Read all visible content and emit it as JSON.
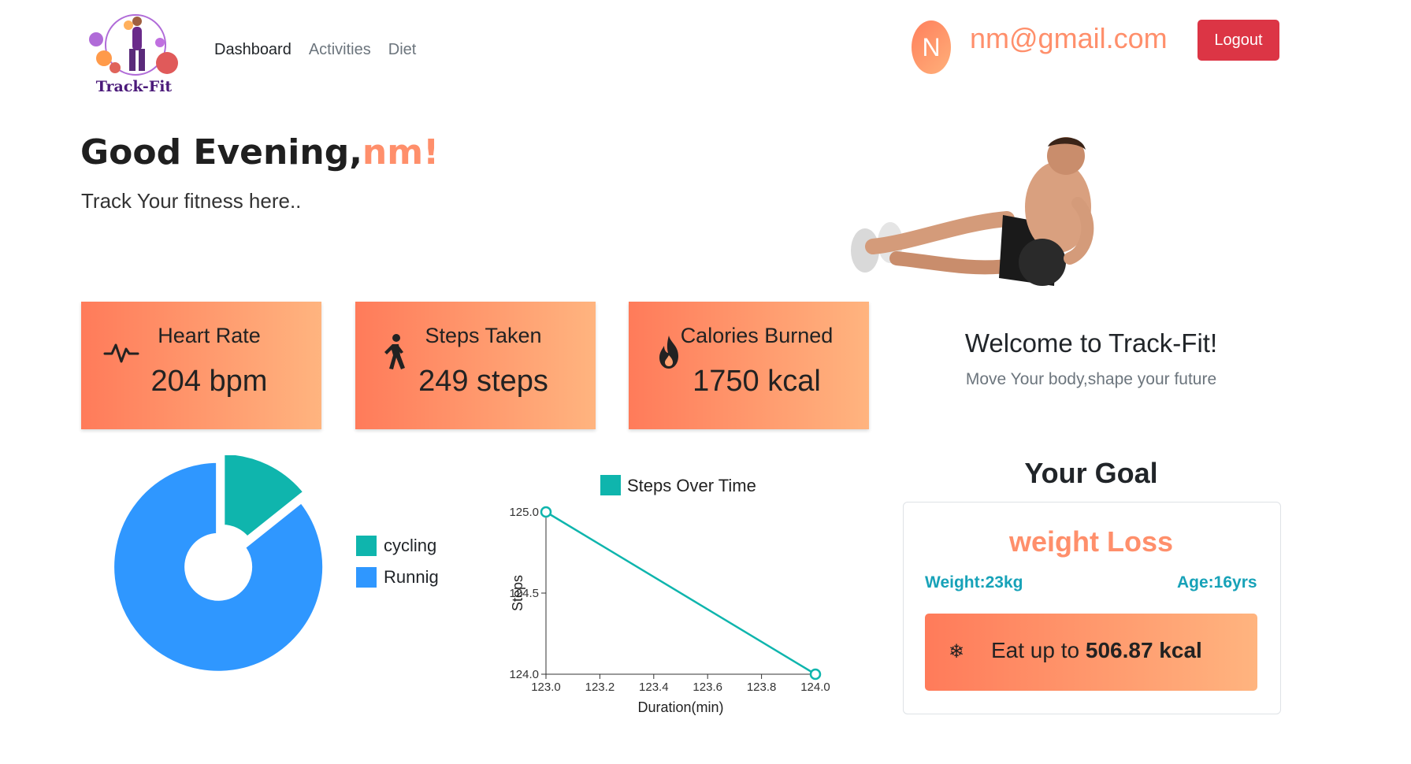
{
  "nav": {
    "logo_text": "Track-Fit",
    "items": [
      "Dashboard",
      "Activities",
      "Diet"
    ]
  },
  "user": {
    "avatar_letter": "N",
    "email": "nm@gmail.com",
    "logout_label": "Logout"
  },
  "greeting": {
    "prefix": "Good Evening,",
    "name": "nm!",
    "subtitle": "Track Your fitness here.."
  },
  "stats": [
    {
      "label": "Heart Rate",
      "value": "204 bpm",
      "icon": "heartbeat-icon"
    },
    {
      "label": "Steps Taken",
      "value": "249 steps",
      "icon": "walking-icon"
    },
    {
      "label": "Calories Burned",
      "value": "1750 kcal",
      "icon": "fire-icon"
    }
  ],
  "welcome": {
    "title": "Welcome to Track-Fit!",
    "tagline": "Move Your body,shape your future"
  },
  "goal": {
    "heading": "Your Goal",
    "name": "weight Loss",
    "weight": "Weight:23kg",
    "age": "Age:16yrs",
    "eat_prefix": "Eat up to",
    "eat_value": "506.87 kcal",
    "eat_icon": "snowflake-icon"
  },
  "colors": {
    "accent": "#ff8f6b",
    "teal": "#0fb5ad",
    "blue": "#2f97ff",
    "danger": "#dc3545",
    "info": "#17a2b8"
  },
  "chart_data": [
    {
      "type": "pie",
      "labels": [
        "cycling",
        "Runnig"
      ],
      "values": [
        1,
        6
      ],
      "colors": [
        "#0fb5ad",
        "#2f97ff"
      ],
      "legend_position": "right"
    },
    {
      "type": "line",
      "title": "Steps Over Time",
      "xlabel": "Duration(min)",
      "ylabel": "Steps",
      "series": [
        {
          "name": "Steps Over Time",
          "x": [
            123.0,
            124.0
          ],
          "y": [
            125.0,
            124.0
          ],
          "color": "#0fb5ad"
        }
      ],
      "xlim": [
        123.0,
        124.0
      ],
      "ylim": [
        124.0,
        125.0
      ],
      "xticks": [
        "123.0",
        "123.2",
        "123.4",
        "123.6",
        "123.8",
        "124.0"
      ],
      "yticks": [
        "124.0",
        "124.5",
        "125.0"
      ],
      "legend_position": "top"
    }
  ]
}
